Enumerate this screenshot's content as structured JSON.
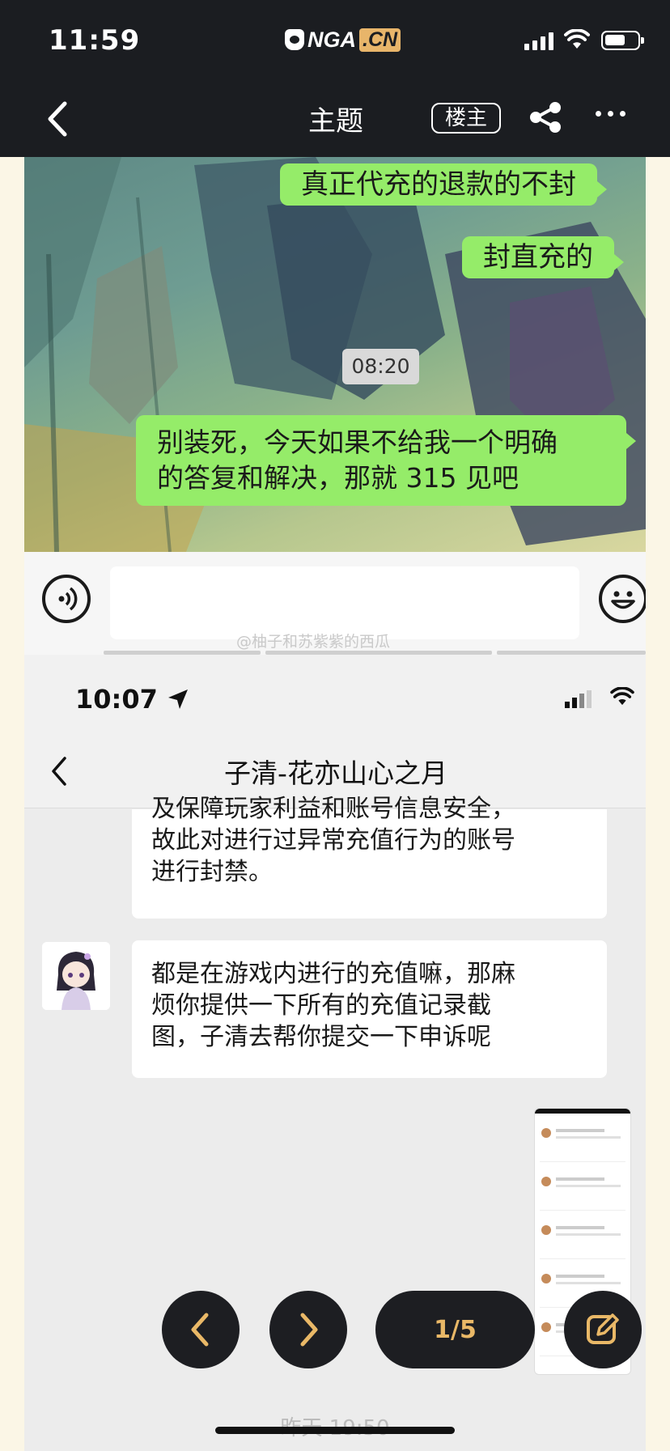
{
  "status_bar": {
    "time": "11:59",
    "logo_text": "NGA",
    "logo_domain": ".CN"
  },
  "header": {
    "title": "主题",
    "louzhu_label": "楼主"
  },
  "screenshot1": {
    "messages": [
      "真正代充的退款的不封",
      "封直充的"
    ],
    "timestamp": "08:20",
    "last_message_line1": "别装死，今天如果不给我一个明确",
    "last_message_line2": "的答复和解决，那就 315 见吧",
    "watermark": "@柚子和苏紫紫的西瓜"
  },
  "screenshot2": {
    "status_time": "10:07",
    "chat_title": "子清-花亦山心之月",
    "message1": {
      "line1": "及保障玩家利益和账号信息安全，",
      "line2": "故此对进行过异常充值行为的账号",
      "line3": "进行封禁。"
    },
    "message2": {
      "line1": "都是在游戏内进行的充值嘛，那麻",
      "line2": "烦你提供一下所有的充值记录截",
      "line3": "图，子清去帮你提交一下申诉呢"
    },
    "bottom_timestamp": "昨天 19:50"
  },
  "pager": {
    "indicator": "1/5"
  },
  "colors": {
    "accent": "#e9b867",
    "wechat_green": "#95ec69",
    "dark": "#1b1d21"
  }
}
